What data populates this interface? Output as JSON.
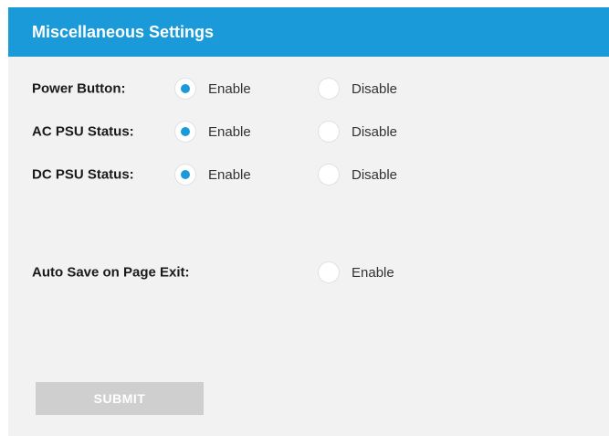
{
  "panel": {
    "title": "Miscellaneous Settings"
  },
  "settings": [
    {
      "label": "Power Button:",
      "options": [
        {
          "label": "Enable",
          "checked": true
        },
        {
          "label": "Disable",
          "checked": false
        }
      ]
    },
    {
      "label": "AC PSU Status:",
      "options": [
        {
          "label": "Enable",
          "checked": true
        },
        {
          "label": "Disable",
          "checked": false
        }
      ]
    },
    {
      "label": "DC PSU Status:",
      "options": [
        {
          "label": "Enable",
          "checked": true
        },
        {
          "label": "Disable",
          "checked": false
        }
      ]
    }
  ],
  "auto_save": {
    "label": "Auto Save on Page Exit:",
    "option_label": "Enable",
    "checked": false
  },
  "submit": {
    "label": "SUBMIT"
  },
  "colors": {
    "accent": "#1a9ad9",
    "panel_background": "#f2f2f2",
    "submit_background": "#cfcfcf"
  }
}
